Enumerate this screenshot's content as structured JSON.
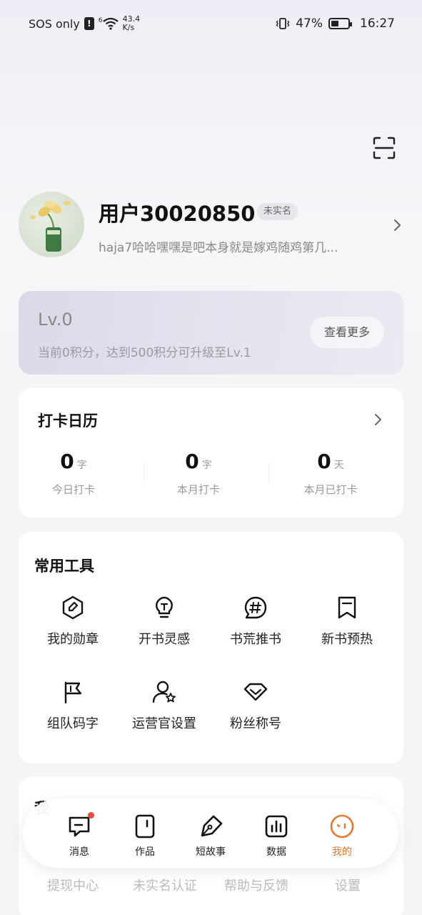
{
  "status_bar": {
    "carrier": "SOS only",
    "alert": "!",
    "network_type": "6",
    "speed_value": "43.4",
    "speed_unit": "K/s",
    "battery_percent": "47%",
    "battery_level": 0.47,
    "time": "16:27"
  },
  "profile": {
    "username": "用户30020850",
    "verify_badge": "未实名",
    "bio": "haja7哈哈嘿嘿是吧本身就是嫁鸡随鸡第几..."
  },
  "level": {
    "title": "Lv.0",
    "description": "当前0积分，达到500积分可升级至Lv.1",
    "button": "查看更多"
  },
  "checkin": {
    "title": "打卡日历",
    "stats": [
      {
        "value": "0",
        "unit": "字",
        "label": "今日打卡"
      },
      {
        "value": "0",
        "unit": "字",
        "label": "本月打卡"
      },
      {
        "value": "0",
        "unit": "天",
        "label": "本月已打卡"
      }
    ]
  },
  "tools": {
    "title": "常用工具",
    "items": [
      {
        "label": "我的勋章",
        "icon": "medal-icon"
      },
      {
        "label": "开书灵感",
        "icon": "lightbulb-icon"
      },
      {
        "label": "书荒推书",
        "icon": "hashtag-bubble-icon"
      },
      {
        "label": "新书预热",
        "icon": "bookmark-icon"
      },
      {
        "label": "组队码字",
        "icon": "flag-icon"
      },
      {
        "label": "运营官设置",
        "icon": "user-star-icon"
      },
      {
        "label": "粉丝称号",
        "icon": "heart-badge-icon"
      }
    ]
  },
  "extra": {
    "title_partial": "我",
    "items": [
      "提现中心",
      "未实名认证",
      "帮助与反馈",
      "设置"
    ]
  },
  "bottom_nav": {
    "items": [
      {
        "label": "消息",
        "icon": "message-icon",
        "badge": true
      },
      {
        "label": "作品",
        "icon": "works-icon"
      },
      {
        "label": "短故事",
        "icon": "pen-icon"
      },
      {
        "label": "数据",
        "icon": "chart-icon"
      },
      {
        "label": "我的",
        "icon": "profile-face-icon",
        "active": true
      }
    ],
    "active_color": "#e8782e"
  }
}
